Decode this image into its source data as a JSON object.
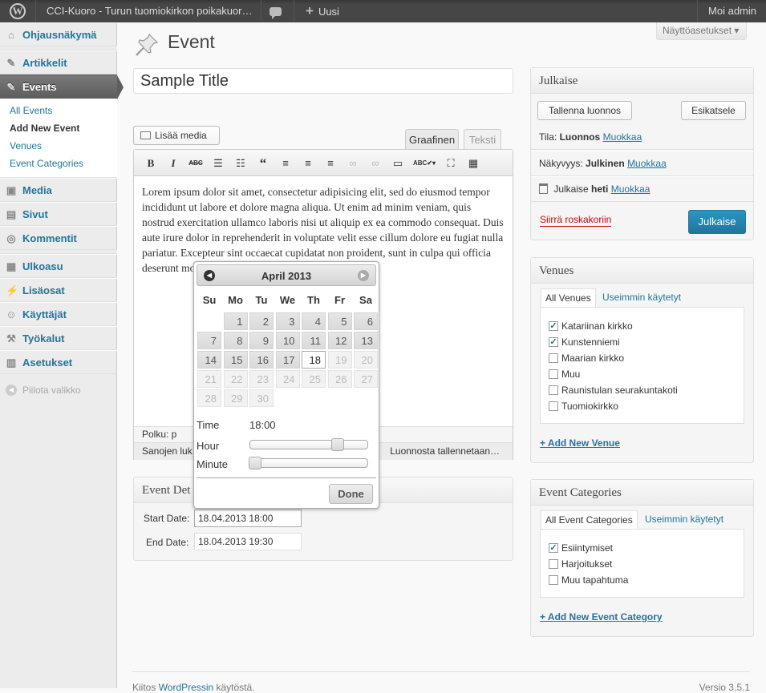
{
  "adminbar": {
    "site_name": "CCI-Kuoro - Turun tuomiokirkon poikakuor…",
    "new_label": "Uusi",
    "howdy": "Moi admin"
  },
  "menu": {
    "dashboard": "Ohjausnäkymä",
    "posts": "Artikkelit",
    "events": "Events",
    "events_sub": [
      "All Events",
      "Add New Event",
      "Venues",
      "Event Categories"
    ],
    "media": "Media",
    "pages": "Sivut",
    "comments": "Kommentit",
    "appearance": "Ulkoasu",
    "plugins": "Lisäosat",
    "users": "Käyttäjät",
    "tools": "Työkalut",
    "settings": "Asetukset",
    "collapse": "Piilota valikko"
  },
  "screen_options": "Näyttöasetukset ▾",
  "page_title": "Event",
  "post_title": "Sample Title",
  "editor": {
    "add_media": "Lisää media",
    "tab_visual": "Graafinen",
    "tab_text": "Teksti",
    "content": "Lorem ipsum dolor sit amet, consectetur adipisicing elit, sed do eiusmod tempor incididunt ut labore et dolore magna aliqua. Ut enim ad minim veniam, quis nostrud exercitation ullamco laboris nisi ut aliquip ex ea commodo consequat. Duis aute irure dolor in reprehenderit in voluptate velit esse cillum dolore eu fugiat nulla pariatur. Excepteur sint occaecat cupidatat non proident, sunt in culpa qui officia deserunt mollit anim id est laborum.",
    "path": "Polku: p",
    "wordcount": "Sanojen luk",
    "autosave": "Luonnosta tallennetaan…"
  },
  "event_details": {
    "title": "Event Det",
    "start_label": "Start Date:",
    "start_value": "18.04.2013 18:00",
    "end_label": "End Date:",
    "end_value": "18.04.2013 19:30"
  },
  "publish": {
    "title": "Julkaise",
    "save_draft": "Tallenna luonnos",
    "preview": "Esikatsele",
    "status_label": "Tila:",
    "status_value": "Luonnos",
    "visibility_label": "Näkyvyys:",
    "visibility_value": "Julkinen",
    "schedule_label": "Julkaise",
    "schedule_value": "heti",
    "edit": "Muokkaa",
    "trash": "Siirrä roskakoriin",
    "publish_button": "Julkaise"
  },
  "venues": {
    "title": "Venues",
    "tab_all": "All Venues",
    "tab_used": "Useimmin käytetyt",
    "items": [
      {
        "label": "Katariinan kirkko",
        "checked": true
      },
      {
        "label": "Kunstenniemi",
        "checked": true
      },
      {
        "label": "Maarian kirkko",
        "checked": false
      },
      {
        "label": "Muu",
        "checked": false
      },
      {
        "label": "Raunistulan seurakuntakoti",
        "checked": false
      },
      {
        "label": "Tuomiokirkko",
        "checked": false
      }
    ],
    "add": "+ Add New Venue"
  },
  "event_categories": {
    "title": "Event Categories",
    "tab_all": "All Event Categories",
    "tab_used": "Useimmin käytetyt",
    "items": [
      {
        "label": "Esiintymiset",
        "checked": true
      },
      {
        "label": "Harjoitukset",
        "checked": false
      },
      {
        "label": "Muu tapahtuma",
        "checked": false
      }
    ],
    "add": "+ Add New Event Category"
  },
  "datepicker": {
    "month": "April 2013",
    "weekdays": [
      "Su",
      "Mo",
      "Tu",
      "We",
      "Th",
      "Fr",
      "Sa"
    ],
    "leading_blanks": 1,
    "days_in_month": 30,
    "selected_day": 18,
    "time_label": "Time",
    "time_value": "18:00",
    "hour_label": "Hour",
    "minute_label": "Minute",
    "hour": 18,
    "minute": 0,
    "done": "Done"
  },
  "footer": {
    "thanks_prefix": "Kiitos",
    "thanks_link": "WordPressin",
    "thanks_suffix": "käytöstä.",
    "version": "Versio 3.5.1"
  }
}
